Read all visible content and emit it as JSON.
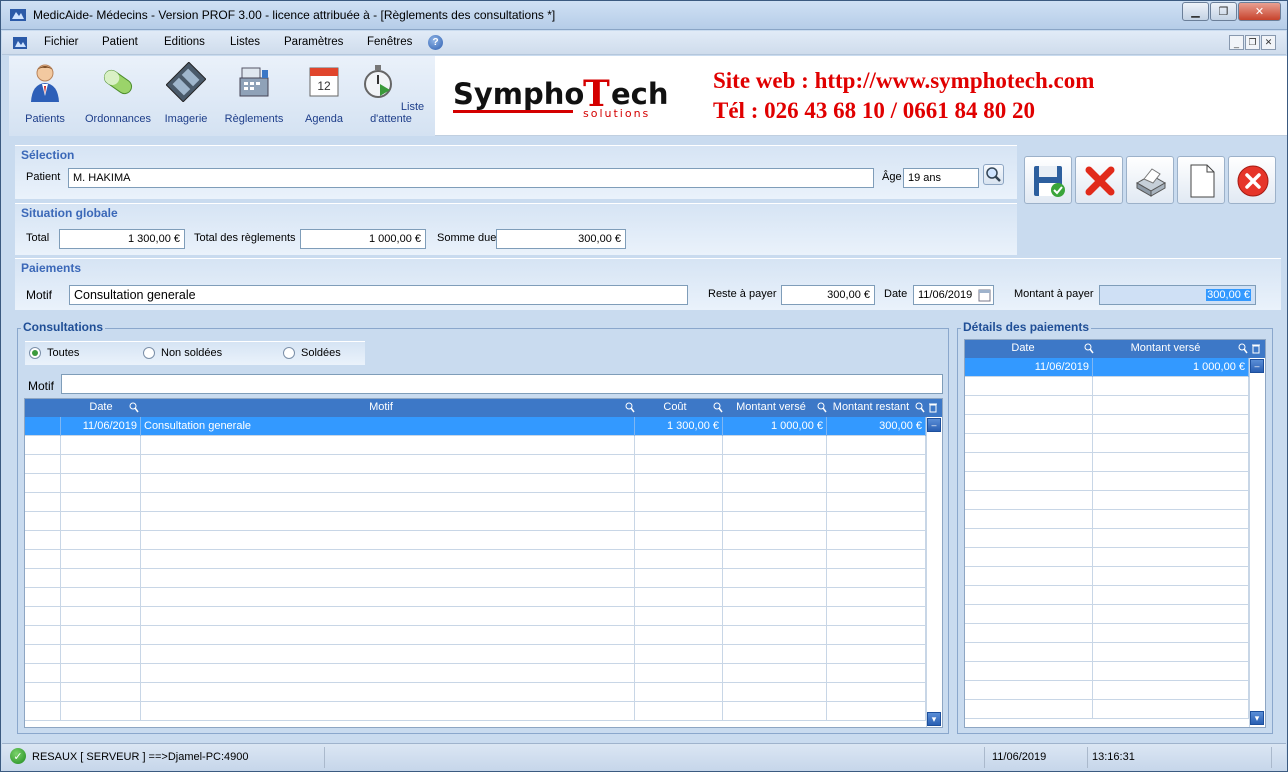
{
  "window": {
    "title": "MedicAide- Médecins - Version PROF 3.00 - licence attribuée à  - [Règlements des consultations *]"
  },
  "menu": {
    "items": [
      "Fichier",
      "Patient",
      "Editions",
      "Listes",
      "Paramètres",
      "Fenêtres"
    ]
  },
  "toolbar": {
    "items": [
      "Patients",
      "Ordonnances",
      "Imagerie",
      "Règlements",
      "Agenda",
      "Liste d'attente"
    ]
  },
  "brand": {
    "logo_main_left": "Sympho",
    "logo_main_T": "T",
    "logo_main_right": "ech",
    "logo_sub": "solutions",
    "line1": "Site web : http://www.symphotech.com",
    "line2": "Tél : 026 43 68 10 / 0661 84 80 20"
  },
  "selection": {
    "title": "Sélection",
    "patient_label": "Patient",
    "patient_value": "M.  HAKIMA",
    "age_label": "Âge",
    "age_value": "19 ans"
  },
  "situation": {
    "title": "Situation globale",
    "total_label": "Total",
    "total_value": "1 300,00 €",
    "reglements_label": "Total des règlements",
    "reglements_value": "1 000,00 €",
    "due_label": "Somme due",
    "due_value": "300,00 €"
  },
  "paiements": {
    "title": "Paiements",
    "motif_label": "Motif",
    "motif_value": "Consultation generale",
    "reste_label": "Reste à payer",
    "reste_value": "300,00 €",
    "date_label": "Date",
    "date_value": "11/06/2019",
    "montant_label": "Montant à payer",
    "montant_value": "300,00 €"
  },
  "consultations": {
    "title": "Consultations",
    "filters": [
      "Toutes",
      "Non soldées",
      "Soldées"
    ],
    "selected_filter": "Toutes",
    "motif_label": "Motif",
    "motif_value": "",
    "columns": [
      "Date",
      "Motif",
      "Coût",
      "Montant versé",
      "Montant restant"
    ],
    "rows": [
      {
        "date": "11/06/2019",
        "motif": "Consultation generale",
        "cout": "1 300,00 €",
        "verse": "1 000,00 €",
        "restant": "300,00 €"
      }
    ]
  },
  "details": {
    "title": "Détails des paiements",
    "columns": [
      "Date",
      "Montant versé"
    ],
    "rows": [
      {
        "date": "11/06/2019",
        "montant": "1 000,00 €"
      }
    ]
  },
  "status": {
    "connection": "RESAUX [ SERVEUR ] ==>Djamel-PC:4900",
    "date": "11/06/2019",
    "time": "13:16:31"
  },
  "colors": {
    "accent": "#3d78c7",
    "selection": "#3399ff",
    "brand_red": "#e00000"
  }
}
